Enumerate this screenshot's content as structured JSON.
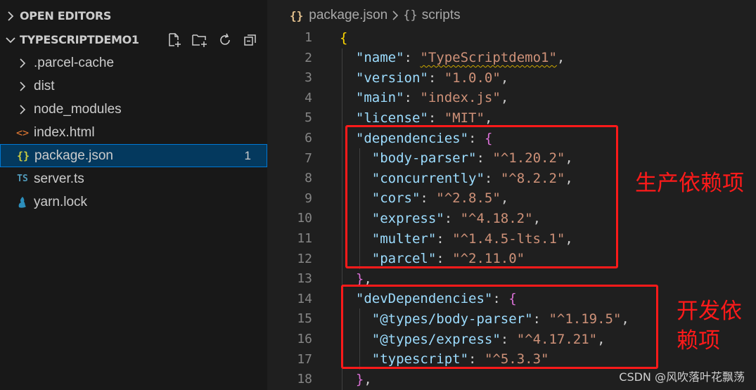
{
  "sidebar": {
    "open_editors_label": "OPEN EDITORS",
    "project_label": "TYPESCRIPTDEMO1",
    "items": [
      {
        "label": ".parcel-cache",
        "type": "folder",
        "icon": "chevron-right-icon"
      },
      {
        "label": "dist",
        "type": "folder",
        "icon": "chevron-right-icon"
      },
      {
        "label": "node_modules",
        "type": "folder",
        "icon": "chevron-right-icon"
      },
      {
        "label": "index.html",
        "type": "file",
        "icon": "html-file-icon",
        "icon_glyph": "<>",
        "icon_color": "#e37933"
      },
      {
        "label": "package.json",
        "type": "file",
        "icon": "json-file-icon",
        "icon_glyph": "{}",
        "icon_color": "#cbcb41",
        "badge": "1",
        "selected": true
      },
      {
        "label": "server.ts",
        "type": "file",
        "icon": "typescript-file-icon",
        "icon_glyph": "TS",
        "icon_color": "#519aba"
      },
      {
        "label": "yarn.lock",
        "type": "file",
        "icon": "yarn-file-icon",
        "icon_color": "#2c8ebb"
      }
    ]
  },
  "breadcrumb": {
    "file_icon": "{}",
    "file": "package.json",
    "section_icon": "{}",
    "section": "scripts"
  },
  "code_lines": [
    {
      "n": "1",
      "tokens": [
        {
          "t": "{",
          "c": "b1"
        }
      ]
    },
    {
      "n": "2",
      "tokens": [
        {
          "t": "  "
        },
        {
          "t": "\"name\"",
          "c": "k"
        },
        {
          "t": ": ",
          "c": "p"
        },
        {
          "t": "\"TypeScriptdemo1\"",
          "c": "s squig"
        },
        {
          "t": ",",
          "c": "p"
        }
      ]
    },
    {
      "n": "3",
      "tokens": [
        {
          "t": "  "
        },
        {
          "t": "\"version\"",
          "c": "k"
        },
        {
          "t": ": ",
          "c": "p"
        },
        {
          "t": "\"1.0.0\"",
          "c": "s"
        },
        {
          "t": ",",
          "c": "p"
        }
      ]
    },
    {
      "n": "4",
      "tokens": [
        {
          "t": "  "
        },
        {
          "t": "\"main\"",
          "c": "k"
        },
        {
          "t": ": ",
          "c": "p"
        },
        {
          "t": "\"index.js\"",
          "c": "s"
        },
        {
          "t": ",",
          "c": "p"
        }
      ]
    },
    {
      "n": "5",
      "tokens": [
        {
          "t": "  "
        },
        {
          "t": "\"license\"",
          "c": "k"
        },
        {
          "t": ": ",
          "c": "p"
        },
        {
          "t": "\"MIT\"",
          "c": "s"
        },
        {
          "t": ",",
          "c": "p"
        }
      ]
    },
    {
      "n": "6",
      "tokens": [
        {
          "t": "  "
        },
        {
          "t": "\"dependencies\"",
          "c": "k"
        },
        {
          "t": ": ",
          "c": "p"
        },
        {
          "t": "{",
          "c": "b2"
        }
      ]
    },
    {
      "n": "7",
      "tokens": [
        {
          "t": "    "
        },
        {
          "t": "\"body-parser\"",
          "c": "k"
        },
        {
          "t": ": ",
          "c": "p"
        },
        {
          "t": "\"^1.20.2\"",
          "c": "s"
        },
        {
          "t": ",",
          "c": "p"
        }
      ]
    },
    {
      "n": "8",
      "tokens": [
        {
          "t": "    "
        },
        {
          "t": "\"concurrently\"",
          "c": "k"
        },
        {
          "t": ": ",
          "c": "p"
        },
        {
          "t": "\"^8.2.2\"",
          "c": "s"
        },
        {
          "t": ",",
          "c": "p"
        }
      ]
    },
    {
      "n": "9",
      "tokens": [
        {
          "t": "    "
        },
        {
          "t": "\"cors\"",
          "c": "k"
        },
        {
          "t": ": ",
          "c": "p"
        },
        {
          "t": "\"^2.8.5\"",
          "c": "s"
        },
        {
          "t": ",",
          "c": "p"
        }
      ]
    },
    {
      "n": "10",
      "tokens": [
        {
          "t": "    "
        },
        {
          "t": "\"express\"",
          "c": "k"
        },
        {
          "t": ": ",
          "c": "p"
        },
        {
          "t": "\"^4.18.2\"",
          "c": "s"
        },
        {
          "t": ",",
          "c": "p"
        }
      ]
    },
    {
      "n": "11",
      "tokens": [
        {
          "t": "    "
        },
        {
          "t": "\"multer\"",
          "c": "k"
        },
        {
          "t": ": ",
          "c": "p"
        },
        {
          "t": "\"^1.4.5-lts.1\"",
          "c": "s"
        },
        {
          "t": ",",
          "c": "p"
        }
      ]
    },
    {
      "n": "12",
      "tokens": [
        {
          "t": "    "
        },
        {
          "t": "\"parcel\"",
          "c": "k"
        },
        {
          "t": ": ",
          "c": "p"
        },
        {
          "t": "\"^2.11.0\"",
          "c": "s"
        }
      ]
    },
    {
      "n": "13",
      "tokens": [
        {
          "t": "  "
        },
        {
          "t": "}",
          "c": "b2"
        },
        {
          "t": ",",
          "c": "p"
        }
      ]
    },
    {
      "n": "14",
      "tokens": [
        {
          "t": "  "
        },
        {
          "t": "\"devDependencies\"",
          "c": "k"
        },
        {
          "t": ": ",
          "c": "p"
        },
        {
          "t": "{",
          "c": "b2"
        }
      ]
    },
    {
      "n": "15",
      "tokens": [
        {
          "t": "    "
        },
        {
          "t": "\"@types/body-parser\"",
          "c": "k"
        },
        {
          "t": ": ",
          "c": "p"
        },
        {
          "t": "\"^1.19.5\"",
          "c": "s"
        },
        {
          "t": ",",
          "c": "p"
        }
      ]
    },
    {
      "n": "16",
      "tokens": [
        {
          "t": "    "
        },
        {
          "t": "\"@types/express\"",
          "c": "k"
        },
        {
          "t": ": ",
          "c": "p"
        },
        {
          "t": "\"^4.17.21\"",
          "c": "s"
        },
        {
          "t": ",",
          "c": "p"
        }
      ]
    },
    {
      "n": "17",
      "tokens": [
        {
          "t": "    "
        },
        {
          "t": "\"typescript\"",
          "c": "k"
        },
        {
          "t": ": ",
          "c": "p"
        },
        {
          "t": "\"^5.3.3\"",
          "c": "s"
        }
      ]
    },
    {
      "n": "18",
      "tokens": [
        {
          "t": "  "
        },
        {
          "t": "}",
          "c": "b2"
        },
        {
          "t": ",",
          "c": "p"
        }
      ]
    }
  ],
  "annotations": {
    "dependencies_label": "生产依赖项",
    "dev_dependencies_line1": "开发依",
    "dev_dependencies_line2": "赖项",
    "box_color": "#ff1a1a"
  },
  "watermark": "CSDN @风吹落叶花飘荡"
}
